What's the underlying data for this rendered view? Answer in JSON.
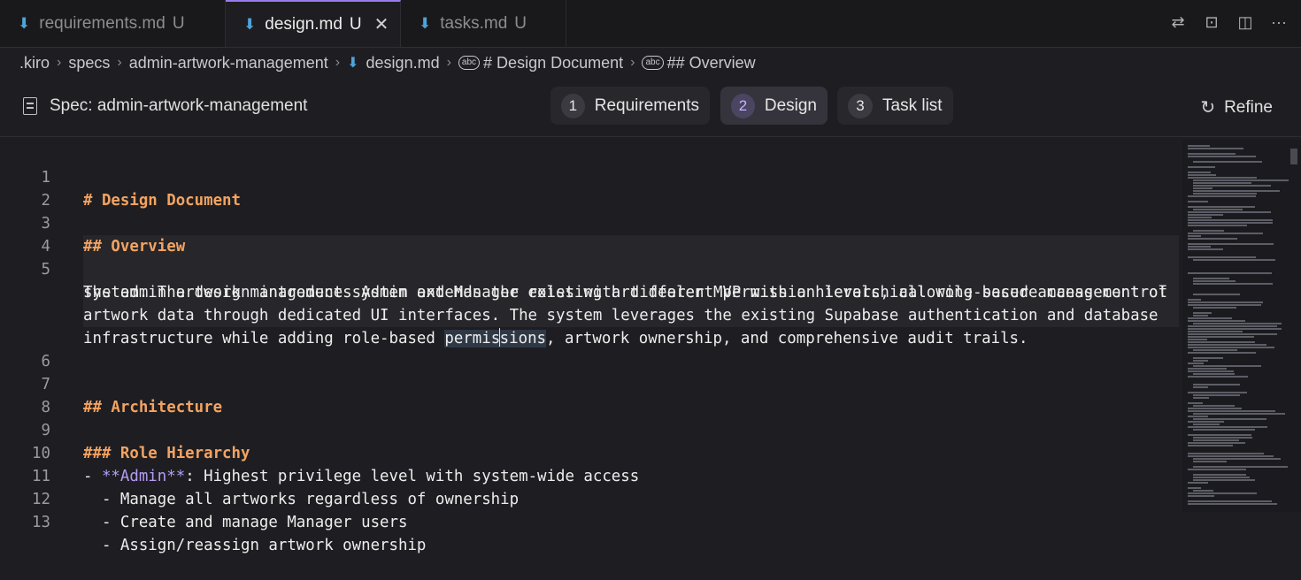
{
  "tabs": [
    {
      "label": "requirements.md",
      "status": "U",
      "active": false
    },
    {
      "label": "design.md",
      "status": "U",
      "active": true
    },
    {
      "label": "tasks.md",
      "status": "U",
      "active": false
    }
  ],
  "breadcrumb": [
    ".kiro",
    "specs",
    "admin-artwork-management",
    "design.md",
    "# Design Document",
    "## Overview"
  ],
  "spec": {
    "title": "Spec: admin-artwork-management",
    "steps": [
      {
        "num": "1",
        "label": "Requirements"
      },
      {
        "num": "2",
        "label": "Design"
      },
      {
        "num": "3",
        "label": "Task list"
      }
    ],
    "refine_label": "Refine"
  },
  "editor": {
    "lines": [
      {
        "n": "1",
        "text": "# Design Document"
      },
      {
        "n": "2",
        "text": ""
      },
      {
        "n": "3",
        "text": "## Overview"
      },
      {
        "n": "4",
        "text": ""
      },
      {
        "n": "5",
        "text": "The admin artwork management system extends the existing art dealer MVP with a hierarchical role-based access control"
      },
      {
        "n": "",
        "text": "system. The design introduces Admin and Manager roles with different permission levels, allowing secure management of"
      },
      {
        "n": "",
        "text": "artwork data through dedicated UI interfaces. The system leverages the existing Supabase authentication and database"
      },
      {
        "n": "",
        "text_before": "infrastructure while adding role-based ",
        "sel_a": "permis",
        "sel_b": "sions",
        "text_after": ", artwork ownership, and comprehensive audit trails."
      },
      {
        "n": "6",
        "text": ""
      },
      {
        "n": "7",
        "text": "## Architecture"
      },
      {
        "n": "8",
        "text": ""
      },
      {
        "n": "9",
        "text": "### Role Hierarchy"
      },
      {
        "n": "10",
        "prefix": "- ",
        "bold": "**Admin**",
        "text": ": Highest privilege level with system-wide access"
      },
      {
        "n": "11",
        "text": "  - Manage all artworks regardless of ownership"
      },
      {
        "n": "12",
        "text": "  - Create and manage Manager users"
      },
      {
        "n": "13",
        "text": "  - Assign/reassign artwork ownership"
      }
    ]
  },
  "colors": {
    "accent": "#9b7bf0",
    "heading": "#f3a361",
    "md_icon": "#4fa3d8"
  }
}
